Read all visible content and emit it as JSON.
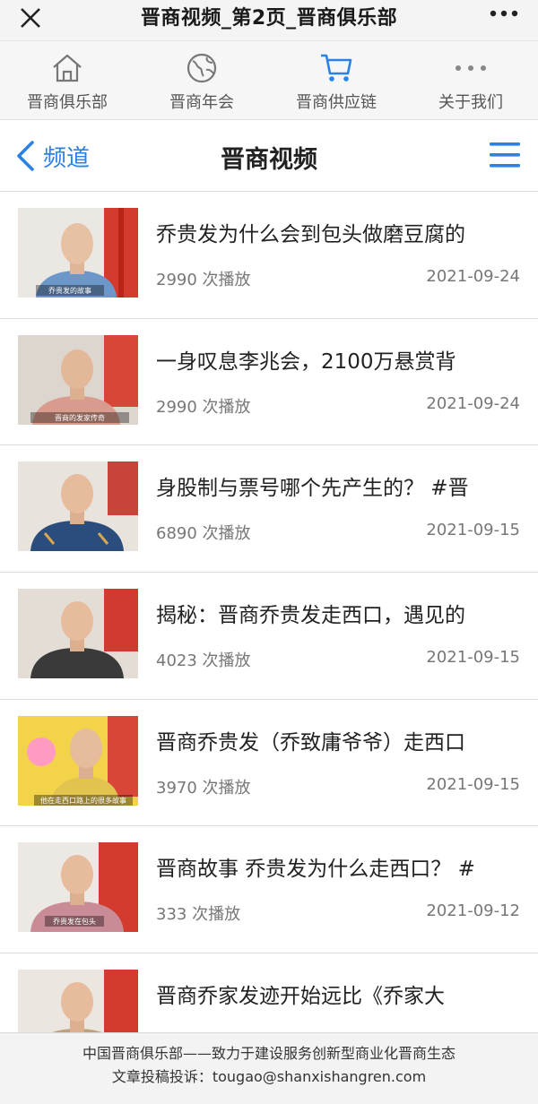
{
  "window": {
    "title": "晋商视频_第2页_晋商俱乐部"
  },
  "nav": [
    {
      "label": "晋商俱乐部",
      "icon": "home-icon"
    },
    {
      "label": "晋商年会",
      "icon": "globe-icon"
    },
    {
      "label": "晋商供应链",
      "icon": "cart-icon"
    },
    {
      "label": "关于我们",
      "icon": "more-dots-icon"
    }
  ],
  "header": {
    "back_label": "频道",
    "title": "晋商视频"
  },
  "videos": [
    {
      "title": "乔贵发为什么会到包头做磨豆腐的",
      "plays": "2990 次播放",
      "date": "2021-09-24"
    },
    {
      "title": "一身叹息李兆会，2100万悬赏背",
      "plays": "2990 次播放",
      "date": "2021-09-24"
    },
    {
      "title": "身股制与票号哪个先产生的？ #晋",
      "plays": "6890 次播放",
      "date": "2021-09-15"
    },
    {
      "title": "揭秘：晋商乔贵发走西口，遇见的",
      "plays": "4023 次播放",
      "date": "2021-09-15"
    },
    {
      "title": "晋商乔贵发（乔致庸爷爷）走西口",
      "plays": "3970 次播放",
      "date": "2021-09-15"
    },
    {
      "title": "晋商故事 乔贵发为什么走西口？ #",
      "plays": "333 次播放",
      "date": "2021-09-12"
    },
    {
      "title": "晋商乔家发迹开始远比《乔家大",
      "plays": "",
      "date": ""
    }
  ],
  "thumb_captions": [
    "乔贵发的故事",
    "晋商的发家传奇",
    "",
    "",
    "他在走西口路上的很多故事",
    "乔贵发在包头",
    ""
  ],
  "footer": {
    "line1": "中国晋商俱乐部——致力于建设服务创新型商业化晋商生态",
    "line2": "文章投稿投诉：tougao@shanxishangren.com"
  },
  "colors": {
    "accent": "#2a82e4",
    "nav_active": "#2a82e4"
  }
}
